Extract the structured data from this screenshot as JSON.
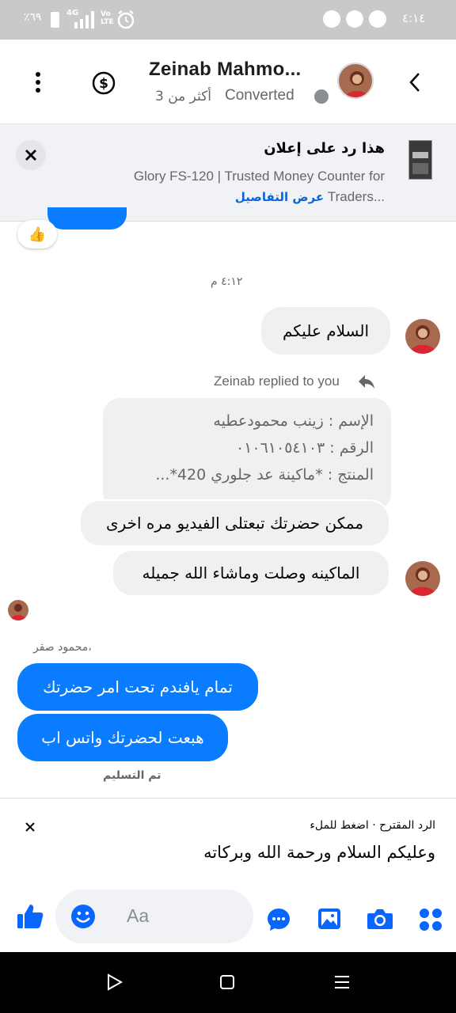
{
  "status_bar": {
    "time": "٤:١٤",
    "battery": "٪٦٩",
    "network": "4G",
    "volte": "Vo LTE"
  },
  "header": {
    "title": "Zeinab Mahmo...",
    "status": "Converted",
    "count": "أكثر من 3"
  },
  "ad_banner": {
    "title": "هذا رد على إعلان",
    "product_line1": "Glory FS-120 | Trusted Money Counter for",
    "product_line2": "Traders...",
    "details_link": "عرض التفاصيل"
  },
  "chat": {
    "reaction_emoji": "👍",
    "timestamp": "٤:١٢ م",
    "msg_greeting": "السلام عليكم",
    "replied_label": "Zeinab replied to you",
    "quote_lines": [
      "الإسم : زينب محمودعطيه",
      "الرقم : ٠١٠٦١٠٥٤١٠٣",
      "المنتج : *ماكينة عد جلوري 420*..."
    ],
    "msg_video": "ممكن حضرتك تبعتلى الفيديو مره اخرى",
    "msg_machine": "الماكينه وصلت وماشاء الله جميله",
    "sender_name": "محمود صقر،",
    "out_msg_1": "تمام يافندم تحت امر حضرتك",
    "out_msg_2": "هبعت لحضرتك واتس اب",
    "delivered": "تم التسليم"
  },
  "suggestion": {
    "label": "الرد المقترح · اضغط للملء",
    "text": "وعليكم السلام ورحمة الله وبركاته"
  },
  "composer": {
    "placeholder": "Aa"
  },
  "colors": {
    "messenger_blue": "#0a7cff",
    "icon_blue": "#0866ff",
    "bubble_gray": "#f0f0f0"
  }
}
